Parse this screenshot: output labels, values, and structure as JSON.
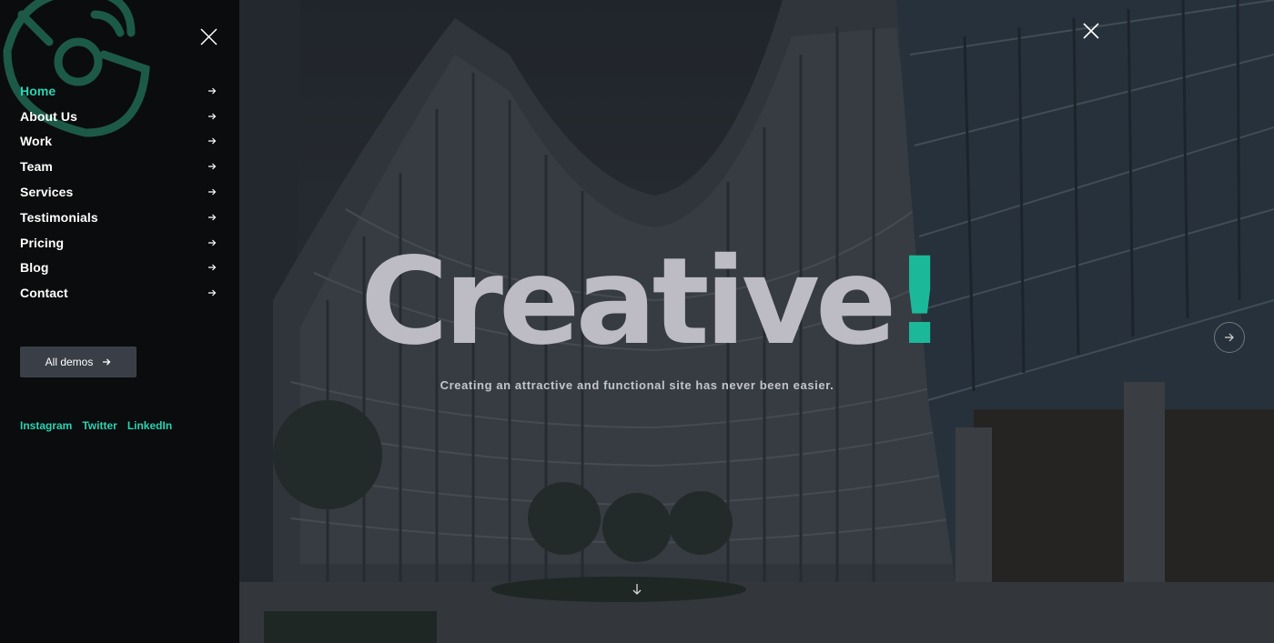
{
  "menu": {
    "items": [
      {
        "label": "Home",
        "active": true
      },
      {
        "label": "About Us",
        "active": false
      },
      {
        "label": "Work",
        "active": false
      },
      {
        "label": "Team",
        "active": false
      },
      {
        "label": "Services",
        "active": false
      },
      {
        "label": "Testimonials",
        "active": false
      },
      {
        "label": "Pricing",
        "active": false
      },
      {
        "label": "Blog",
        "active": false
      },
      {
        "label": "Contact",
        "active": false
      }
    ],
    "demos_label": "All demos",
    "social": [
      "Instagram",
      "Twitter",
      "LinkedIn"
    ],
    "icons": {
      "logo": "logo-mark",
      "close": "close-icon",
      "item_arrow": "arrow-right-icon"
    }
  },
  "hero": {
    "title_main": "Creative",
    "title_accent": "!",
    "subtitle": "Creating an attractive and functional site has never been easier.",
    "icons": {
      "close": "close-icon",
      "next": "arrow-right-circle-icon",
      "scroll": "arrow-down-icon"
    }
  },
  "colors": {
    "accent": "#2ad3b3",
    "accent_dark": "#1bb99a",
    "sidebar_bg": "#0b0c0d",
    "button_bg": "#3a3f47",
    "hero_title": "#bdbcc4"
  }
}
